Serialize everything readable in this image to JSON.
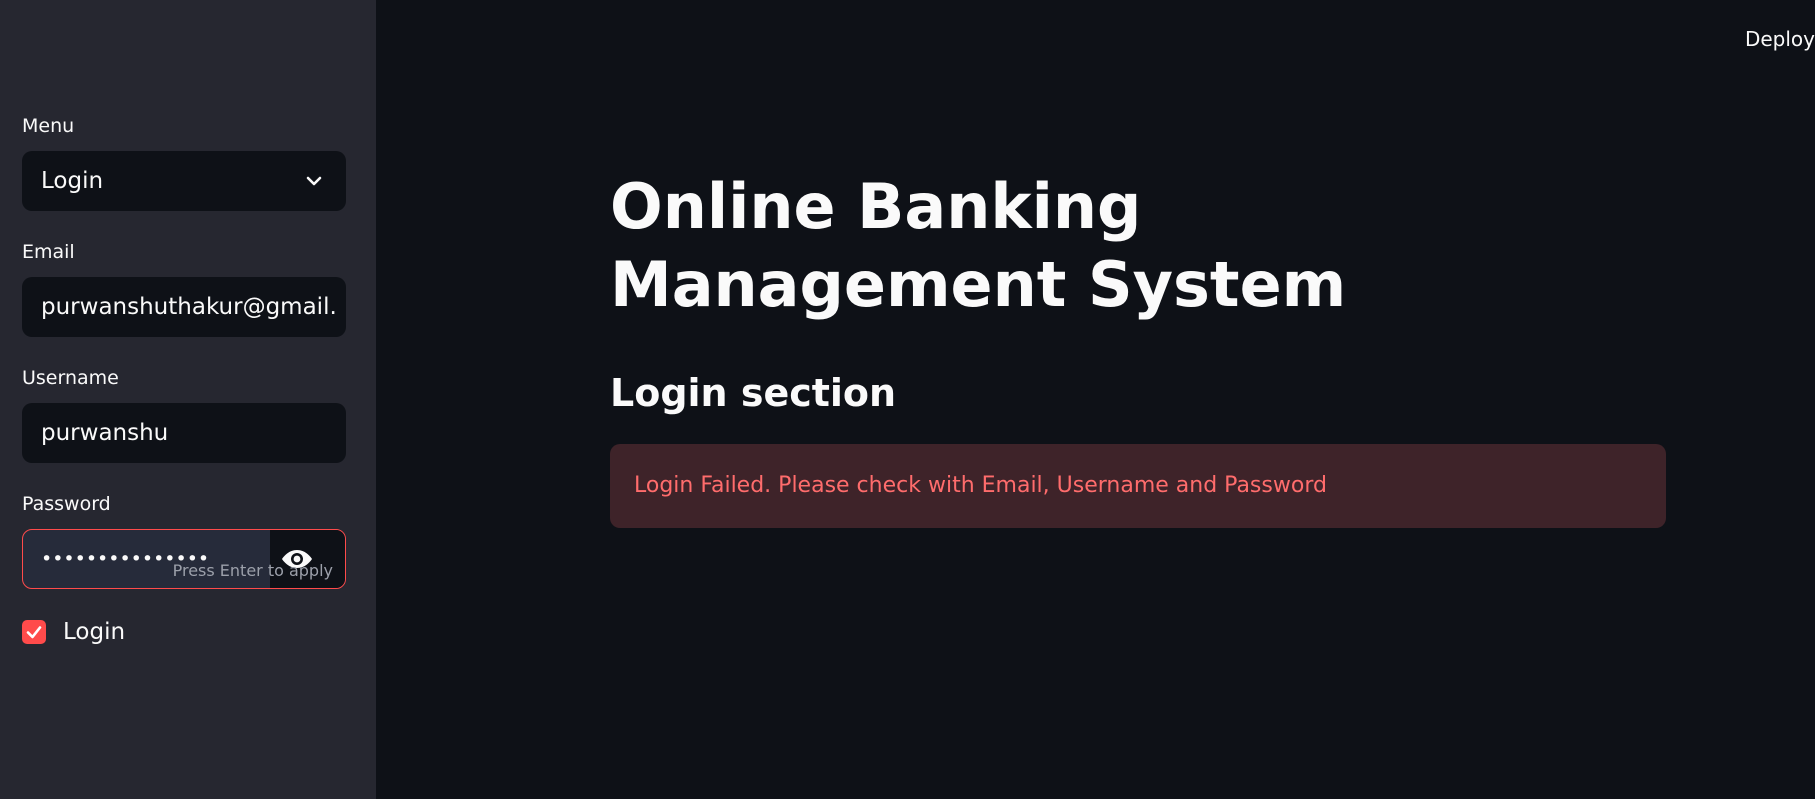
{
  "sidebar": {
    "menu": {
      "label": "Menu",
      "selected": "Login"
    },
    "email": {
      "label": "Email",
      "value": "purwanshuthakur@gmail.com"
    },
    "username": {
      "label": "Username",
      "value": "purwanshu"
    },
    "password": {
      "label": "Password",
      "masked_value": "•••••••••••••••",
      "hint": "Press Enter to apply",
      "toggle_icon": "eye-icon"
    },
    "login_checkbox": {
      "label": "Login",
      "checked": true
    }
  },
  "header": {
    "deploy_label": "Deploy"
  },
  "main": {
    "title": "Online Banking Management System",
    "section_title": "Login section",
    "error_message": "Login Failed. Please check with Email, Username and Password"
  },
  "colors": {
    "sidebar_bg": "#262730",
    "main_bg": "#0e1117",
    "accent": "#ff4b4b",
    "error_bg": "#3e2329",
    "error_text": "#ff6c6c"
  }
}
